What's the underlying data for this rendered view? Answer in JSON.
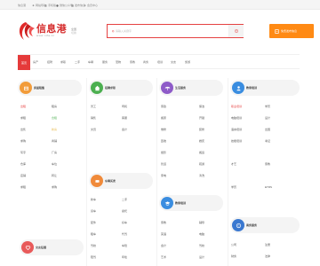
{
  "topbar": {
    "items": [
      "信息港",
      "网站导航",
      "手机版",
      "微信公众号",
      "发布信息",
      "会员中心"
    ],
    "colors": [
      "#999999",
      "#999999",
      "#999999",
      "#999999",
      "#999999",
      "#999999"
    ]
  },
  "header": {
    "logo_text": "信息港",
    "logo_url": "www.ntfa.cc",
    "city_name": "全国",
    "city_switch": "切换",
    "search_placeholder": "请输入关键字",
    "post_label": "免费发布信息"
  },
  "nav": {
    "home": "首页",
    "items": [
      "房产",
      "招聘",
      "求职",
      "二手",
      "车辆",
      "服务",
      "宠物",
      "家教",
      "商务",
      "培训",
      "交友",
      "旅游"
    ]
  },
  "categories": {
    "c1": {
      "title": "房屋租售",
      "color": "#f29c3a"
    },
    "c2": {
      "title": "招聘求职",
      "color": "#4caf50"
    },
    "c3": {
      "title": "生活服务",
      "color": "#8e5bc8"
    },
    "c4": {
      "title": "教育培训",
      "color": "#3a8de0"
    },
    "c5": {
      "title": "车辆买卖",
      "color": "#f08a3a"
    },
    "c6": {
      "title": "教育培训",
      "color": "#3a8de0"
    },
    "c7": {
      "title": "商务服务",
      "color": "#3a78d0"
    },
    "c8": {
      "title": "交友征婚",
      "color": "#e85a5a"
    }
  },
  "col1": {
    "rows": [
      [
        "出租",
        "租房"
      ],
      [
        "求租",
        "合租"
      ],
      [
        "出售",
        "新房"
      ],
      [
        "求购",
        "商铺"
      ],
      [
        "写字",
        "厂房"
      ],
      [
        "仓库",
        "车位"
      ],
      [
        "店铺",
        "转让"
      ],
      [
        "求租",
        "求购"
      ]
    ]
  },
  "col2": {
    "rows": [
      [
        "普工",
        "司机"
      ],
      [
        "销售",
        "客服"
      ],
      [
        "文员",
        "会计"
      ]
    ],
    "rows2": [
      [
        "新车",
        "二手"
      ],
      [
        "货车",
        "摩托"
      ],
      [
        "配件",
        "维修"
      ],
      [
        "租车",
        "代驾"
      ],
      [
        "驾校",
        "车险"
      ],
      [
        "陪驾",
        "年检"
      ]
    ],
    "special": "好车"
  },
  "col3": {
    "rows": [
      [
        "家政",
        "保洁"
      ],
      [
        "搬家",
        "开锁"
      ],
      [
        "维修",
        "装修"
      ],
      [
        "回收",
        "婚庆"
      ],
      [
        "摄影",
        "搬运"
      ],
      [
        "管道",
        "疏通"
      ],
      [
        "家电",
        "清洗"
      ]
    ],
    "rows2": [
      [
        "家教",
        "辅导"
      ],
      [
        "英语",
        "电脑"
      ],
      [
        "会计",
        "驾校"
      ],
      [
        "艺术",
        "设计"
      ]
    ]
  },
  "col4": {
    "rows": [
      [
        "职业培训",
        "学历"
      ],
      [
        "电脑培训",
        "设计"
      ],
      [
        "语言培训",
        "出国"
      ],
      [
        "技能培训",
        "考证"
      ],
      [
        "才艺",
        "家教"
      ],
      [
        "学历",
        "ETRS"
      ]
    ],
    "rows2": [
      [
        "公司",
        "注册"
      ],
      [
        "财务",
        "法律"
      ],
      [
        "广告",
        "印刷"
      ]
    ]
  }
}
